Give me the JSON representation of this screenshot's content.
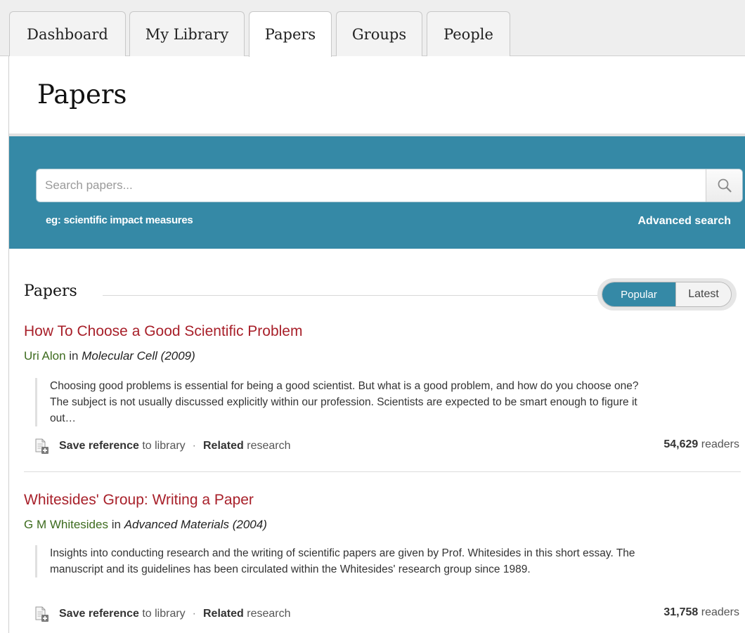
{
  "tabs": [
    {
      "label": "Dashboard"
    },
    {
      "label": "My Library"
    },
    {
      "label": "Papers"
    },
    {
      "label": "Groups"
    },
    {
      "label": "People"
    }
  ],
  "active_tab": "Papers",
  "page_title": "Papers",
  "search": {
    "placeholder": "Search papers...",
    "hint": "eg: scientific impact measures",
    "advanced_label": "Advanced search"
  },
  "section": {
    "title": "Papers",
    "toggle": {
      "popular": "Popular",
      "latest": "Latest",
      "selected": "Popular"
    }
  },
  "papers": [
    {
      "title": "How To Choose a Good Scientific Problem",
      "author": "Uri Alon",
      "in_word": "in",
      "journal": "Molecular Cell (2009)",
      "abstract": "Choosing good problems is essential for being a good scientist. But what is a good problem, and how do you choose one? The subject is not usually discussed explicitly within our profession. Scientists are expected to be smart enough to figure it out…",
      "save_bold": "Save reference",
      "save_rest": "to library",
      "separator": "·",
      "related_bold": "Related",
      "related_rest": "research",
      "readers_count": "54,629",
      "readers_label": "readers"
    },
    {
      "title": "Whitesides' Group: Writing a Paper",
      "author": "G M Whitesides",
      "in_word": "in",
      "journal": "Advanced Materials (2004)",
      "abstract": "Insights into conducting research and the writing of scientific papers are given by Prof. Whitesides in this short essay. The manuscript and its guidelines has been circulated within the Whitesides' research group since 1989.",
      "save_bold": "Save reference",
      "save_rest": "to library",
      "separator": "·",
      "related_bold": "Related",
      "related_rest": "research",
      "readers_count": "31,758",
      "readers_label": "readers"
    }
  ],
  "colors": {
    "accent_blue": "#3589a6",
    "title_red": "#a8202a",
    "author_green": "#3d6b1e"
  },
  "icons": [
    "search-icon",
    "save-document-icon"
  ]
}
